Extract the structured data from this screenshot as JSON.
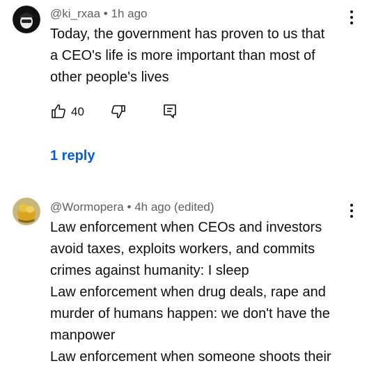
{
  "comments": [
    {
      "handle": "@ki_rxaa",
      "separator": "•",
      "time": "1h ago",
      "lines": [
        "Today, the government has proven to us that",
        "a CEO's life is more important than most of",
        "other people's lives"
      ],
      "like_count": "40",
      "reply_label": "1 reply",
      "icons": {
        "avatar": "avatar-dark",
        "like": "thumbs-up-icon",
        "dislike": "thumbs-down-icon",
        "reply": "reply-icon",
        "menu": "more-vert-icon"
      }
    },
    {
      "handle": "@Wormopera",
      "separator": "•",
      "time": "4h ago (edited)",
      "lines": [
        "Law enforcement when CEOs and investors",
        "avoid taxes, exploits workers, and commits",
        "crimes against humanity: I sleep",
        "Law enforcement when drug deals, rape and",
        "murder of humans happen: we don't have the",
        "manpower",
        "Law enforcement when someone shoots their"
      ],
      "icons": {
        "avatar": "avatar-gold",
        "menu": "more-vert-icon"
      }
    }
  ],
  "colors": {
    "text": "#0f0f0f",
    "meta": "#606060",
    "link": "#065fd4"
  }
}
